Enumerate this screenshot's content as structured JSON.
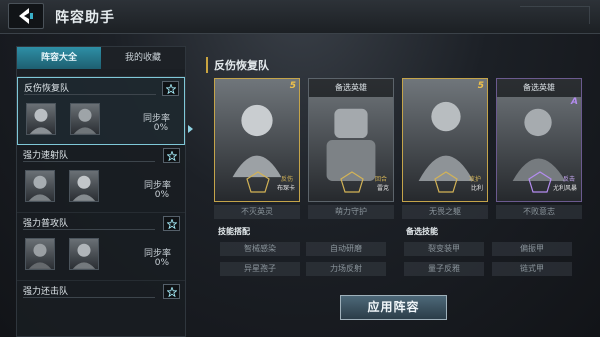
{
  "header": {
    "title": "阵容助手"
  },
  "tabs": [
    {
      "label": "阵容大全"
    },
    {
      "label": "我的收藏"
    }
  ],
  "teams": [
    {
      "name": "反伤恢复队",
      "sync_label": "同步率",
      "sync_value": "0%"
    },
    {
      "name": "强力速射队",
      "sync_label": "同步率",
      "sync_value": "0%"
    },
    {
      "name": "强力普攻队",
      "sync_label": "同步率",
      "sync_value": "0%"
    },
    {
      "name": "强力还击队"
    }
  ],
  "lineup": {
    "title": "反伤恢复队",
    "heroes": [
      {
        "caption": "",
        "role": "反伤",
        "name": "布琛卡",
        "stars": "5",
        "skill": "不灭英灵"
      },
      {
        "caption": "备选英雄",
        "role": "回合",
        "name": "雷克",
        "stars": "",
        "skill": "萌力守护"
      },
      {
        "caption": "",
        "role": "攻护",
        "name": "比利",
        "stars": "5",
        "skill": "无畏之躯"
      },
      {
        "caption": "备选英雄",
        "role": "反击",
        "name": "尤利风暴",
        "stars": "A",
        "skill": "不败意志"
      }
    ],
    "skills_label": "技能搭配",
    "skills": [
      "智械感染",
      "自动研磨",
      "异星孢子",
      "力场反射"
    ],
    "alt_skills_label": "备选技能",
    "alt_skills": [
      "裂变装甲",
      "偏振甲",
      "量子反雅",
      "链式甲"
    ]
  },
  "apply_button": "应用阵容",
  "colors": {
    "accent": "#2e8fa6",
    "gold": "#c4a44a",
    "purple": "#6b5a8f"
  }
}
